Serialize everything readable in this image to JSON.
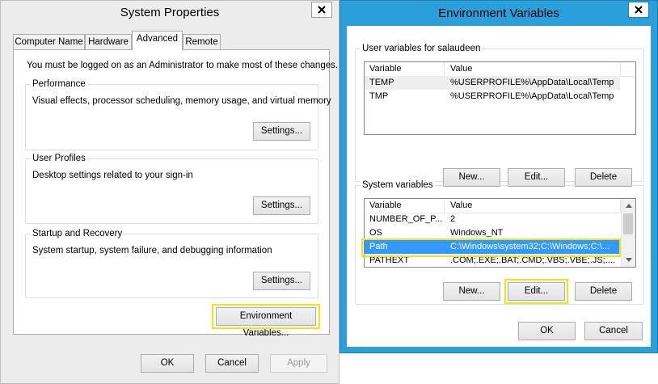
{
  "system_properties": {
    "title": "System Properties",
    "tabs": [
      {
        "label": "Computer Name"
      },
      {
        "label": "Hardware"
      },
      {
        "label": "Advanced"
      },
      {
        "label": "Remote"
      }
    ],
    "admin_note": "You must be logged on as an Administrator to make most of these changes.",
    "performance": {
      "label": "Performance",
      "description": "Visual effects, processor scheduling, memory usage, and virtual memory",
      "button": "Settings..."
    },
    "user_profiles": {
      "label": "User Profiles",
      "description": "Desktop settings related to your sign-in",
      "button": "Settings..."
    },
    "startup_recovery": {
      "label": "Startup and Recovery",
      "description": "System startup, system failure, and debugging information",
      "button": "Settings..."
    },
    "env_vars_button": "Environment Variables...",
    "ok": "OK",
    "cancel": "Cancel",
    "apply": "Apply"
  },
  "environment_variables": {
    "title": "Environment Variables",
    "user_group_label": "User variables for salaudeen",
    "columns": {
      "variable": "Variable",
      "value": "Value"
    },
    "user_vars": [
      {
        "variable": "TEMP",
        "value": "%USERPROFILE%\\AppData\\Local\\Temp"
      },
      {
        "variable": "TMP",
        "value": "%USERPROFILE%\\AppData\\Local\\Temp"
      }
    ],
    "user_buttons": {
      "new": "New...",
      "edit": "Edit...",
      "delete": "Delete"
    },
    "system_group_label": "System variables",
    "system_vars": [
      {
        "variable": "NUMBER_OF_P...",
        "value": "2"
      },
      {
        "variable": "OS",
        "value": "Windows_NT"
      },
      {
        "variable": "Path",
        "value": "C:\\Windows\\system32;C:\\Windows;C:\\..."
      },
      {
        "variable": "PATHEXT",
        "value": ".COM;.EXE;.BAT;.CMD;.VBS;.VBE;.JS;...."
      }
    ],
    "system_buttons": {
      "new": "New...",
      "edit": "Edit...",
      "delete": "Delete"
    },
    "ok": "OK",
    "cancel": "Cancel"
  },
  "colors": {
    "frame_blue": "#2b9fd9",
    "frame_gray": "#ececec",
    "selection": "#3399ff",
    "highlight_yellow": "#f2e410"
  },
  "icons": {
    "close": "close-icon",
    "scroll_up": "chevron-up-icon",
    "scroll_down": "chevron-down-icon"
  }
}
